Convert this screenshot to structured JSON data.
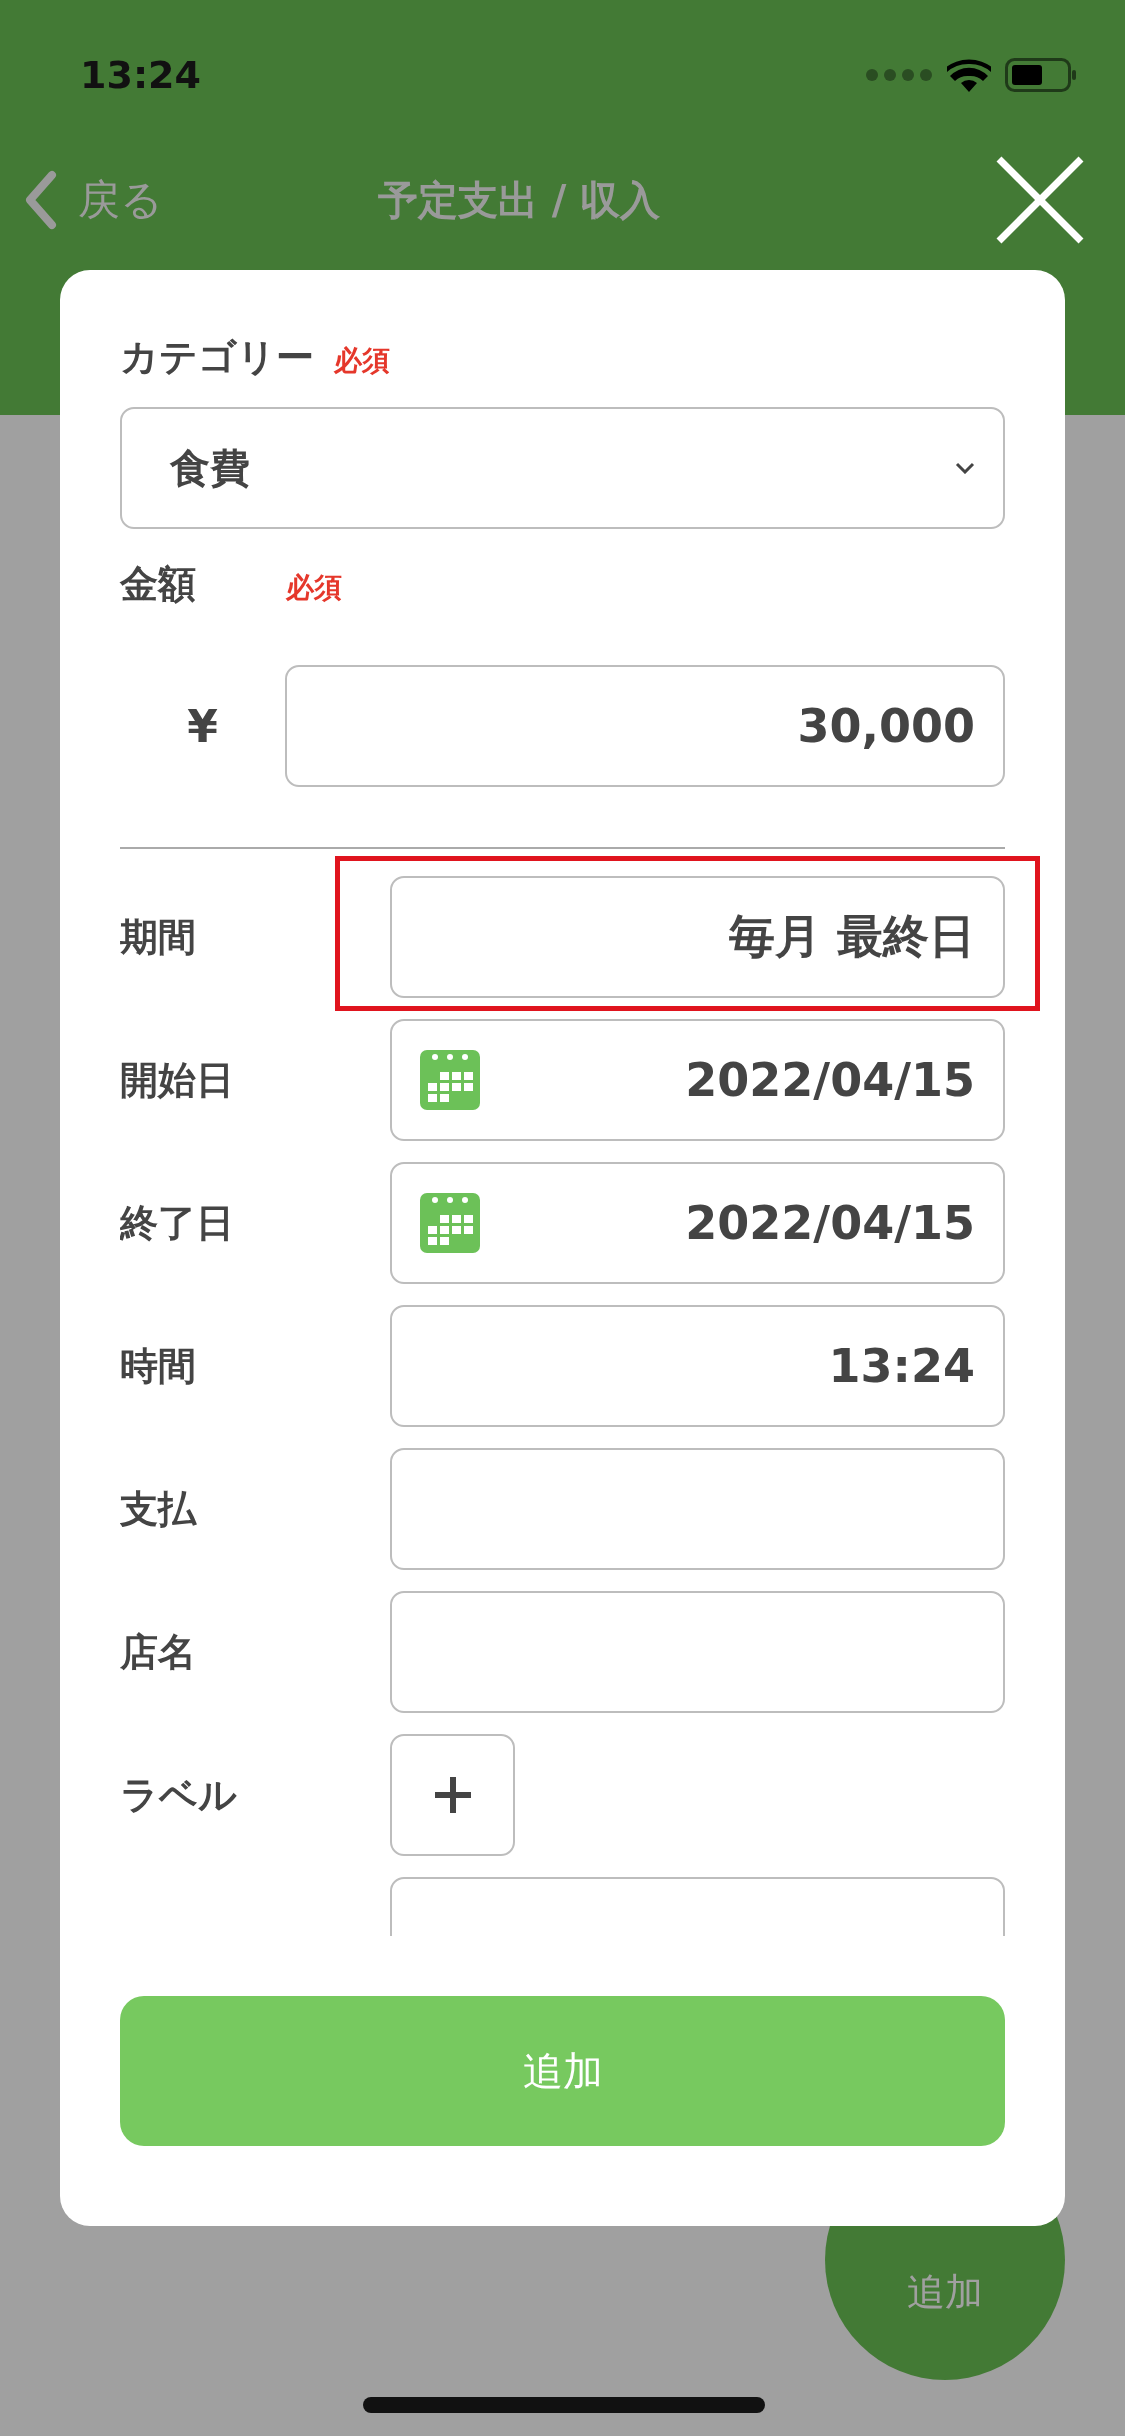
{
  "status_bar": {
    "time": "13:24"
  },
  "nav": {
    "back": "戻る",
    "title": "予定支出 / 収入"
  },
  "form": {
    "category": {
      "label": "カテゴリー",
      "required": "必須",
      "value": "食費"
    },
    "amount": {
      "label": "金額",
      "required": "必須",
      "currency": "¥",
      "value": "30,000"
    },
    "rows": [
      {
        "kind": "text",
        "label": "期間",
        "value": "毎月 最終日",
        "highlighted": true
      },
      {
        "kind": "date",
        "label": "開始日",
        "value": "2022/04/15",
        "highlighted": false
      },
      {
        "kind": "date",
        "label": "終了日",
        "value": "2022/04/15",
        "highlighted": false
      },
      {
        "kind": "text",
        "label": "時間",
        "value": "13:24",
        "highlighted": false
      },
      {
        "kind": "text",
        "label": "支払",
        "highlighted": false
      },
      {
        "kind": "text",
        "label": "店名",
        "highlighted": false
      },
      {
        "kind": "add",
        "label": "ラベル",
        "highlighted": false
      },
      {
        "kind": "text",
        "highlighted": false
      }
    ],
    "submit": "追加"
  },
  "fab": {
    "label": "追加"
  }
}
